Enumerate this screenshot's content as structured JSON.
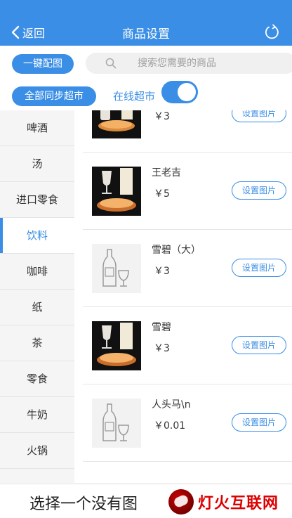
{
  "header": {
    "back_label": "返回",
    "title": "商品设置"
  },
  "toolbar": {
    "one_key_label": "一键配图",
    "search_placeholder": "搜索您需要的商品",
    "sync_all_label": "全部同步超市",
    "online_label": "在线超市",
    "online_toggle": true
  },
  "sidebar": {
    "items": [
      {
        "label": "啤酒"
      },
      {
        "label": "汤"
      },
      {
        "label": "进口零食"
      },
      {
        "label": "饮料"
      },
      {
        "label": "咖啡"
      },
      {
        "label": "纸"
      },
      {
        "label": "茶"
      },
      {
        "label": "零食"
      },
      {
        "label": "牛奶"
      },
      {
        "label": "火锅"
      }
    ],
    "active_index": 3
  },
  "products": [
    {
      "name": "",
      "price": "￥3",
      "image": "photo",
      "button": "设置图片"
    },
    {
      "name": "王老吉",
      "price": "￥5",
      "image": "photo",
      "button": "设置图片"
    },
    {
      "name": "雪碧（大）",
      "price": "￥3",
      "image": "placeholder",
      "button": "设置图片"
    },
    {
      "name": "雪碧",
      "price": "￥3",
      "image": "photo",
      "button": "设置图片"
    },
    {
      "name": "人头马\\n",
      "price": "￥0.01",
      "image": "placeholder",
      "button": "设置图片"
    }
  ],
  "bottom": {
    "note": "选择一个没有图",
    "watermark": "灯火互联网"
  },
  "colors": {
    "accent": "#3a8ee6",
    "sidebar_bg": "#f5f5f5"
  }
}
